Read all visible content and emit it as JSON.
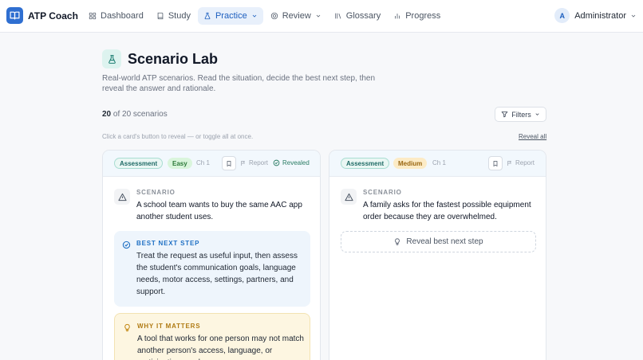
{
  "app": {
    "name": "ATP Coach",
    "icon": "book-open-icon"
  },
  "nav": [
    {
      "label": "Dashboard",
      "icon": "dashboard-icon",
      "active": false
    },
    {
      "label": "Study",
      "icon": "book-icon",
      "active": false
    },
    {
      "label": "Practice",
      "icon": "flask-icon",
      "active": true
    },
    {
      "label": "Review",
      "icon": "globe-icon",
      "active": false
    },
    {
      "label": "Glossary",
      "icon": "library-icon",
      "active": false
    },
    {
      "label": "Progress",
      "icon": "chart-icon",
      "active": false
    }
  ],
  "user": {
    "initial": "A",
    "name": "Administrator"
  },
  "page": {
    "title": "Scenario Lab",
    "icon": "flask-icon",
    "description": "Real-world ATP scenarios. Read the situation, decide the best next step, then reveal the answer and rationale.",
    "count_shown": "20",
    "count_rest": "of 20 scenarios",
    "filters_label": "Filters",
    "hint": "Click a card's button to reveal — or toggle all at once.",
    "reveal_all_label": "Reveal all"
  },
  "cards": [
    {
      "category": "Assessment",
      "difficulty": "Easy",
      "chapter": "Ch 1",
      "report_label": "Report",
      "status": "Revealed",
      "scenario_label": "SCENARIO",
      "scenario": "A school team wants to buy the same AAC app another student uses.",
      "answer_label": "BEST NEXT STEP",
      "answer": "Treat the request as useful input, then assess the student's communication goals, language needs, motor access, settings, partners, and support.",
      "why_label": "WHY IT MATTERS",
      "why": "A tool that works for one person may not match another person's access, language, or participation needs."
    },
    {
      "category": "Assessment",
      "difficulty": "Medium",
      "chapter": "Ch 1",
      "report_label": "Report",
      "scenario_label": "SCENARIO",
      "scenario": "A family asks for the fastest possible equipment order because they are overwhelmed.",
      "reveal_label": "Reveal best next step"
    }
  ],
  "colors": {
    "brand": "#2f6fd1",
    "nav_active_bg": "#e8f0fb",
    "answer_bg": "#eef5fc",
    "why_bg": "#fdf6e1",
    "easy_bg": "#daf5dc",
    "medium_bg": "#fcebc6"
  }
}
